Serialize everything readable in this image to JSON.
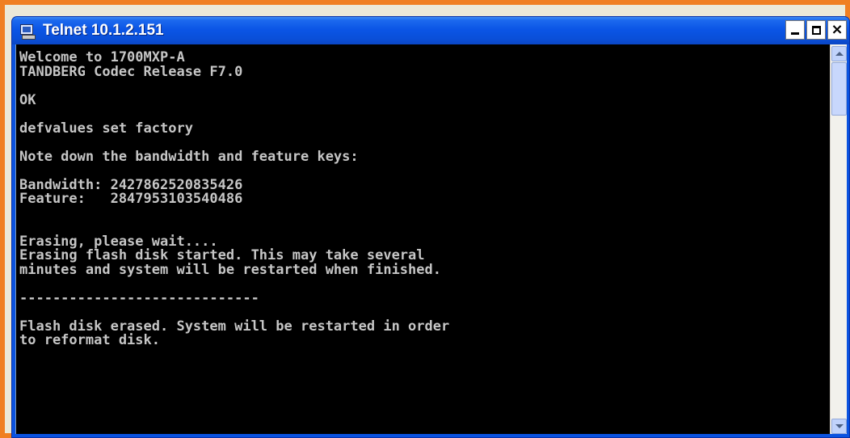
{
  "window": {
    "title": "Telnet 10.1.2.151",
    "icon": "telnet-computer-icon",
    "controls": {
      "minimize": "_",
      "maximize": "□",
      "close": "×"
    }
  },
  "console": {
    "lines": [
      "Welcome to 1700MXP-A",
      "TANDBERG Codec Release F7.0",
      "",
      "OK",
      "",
      "defvalues set factory",
      "",
      "Note down the bandwidth and feature keys:",
      "",
      "Bandwidth: 2427862520835426",
      "Feature:   2847953103540486",
      "",
      "",
      "Erasing, please wait....",
      "Erasing flash disk started. This may take several",
      "minutes and system will be restarted when finished.",
      "",
      "-----------------------------",
      "",
      "Flash disk erased. System will be restarted in order",
      "to reformat disk."
    ],
    "text_color": "#c6c6c6",
    "background": "#000000"
  },
  "scrollbar": {
    "up_icon": "scroll-up-arrow-icon",
    "down_icon": "scroll-down-arrow-icon"
  },
  "colors": {
    "frame_border": "#f07f22",
    "titlebar": "#0b55e6"
  }
}
